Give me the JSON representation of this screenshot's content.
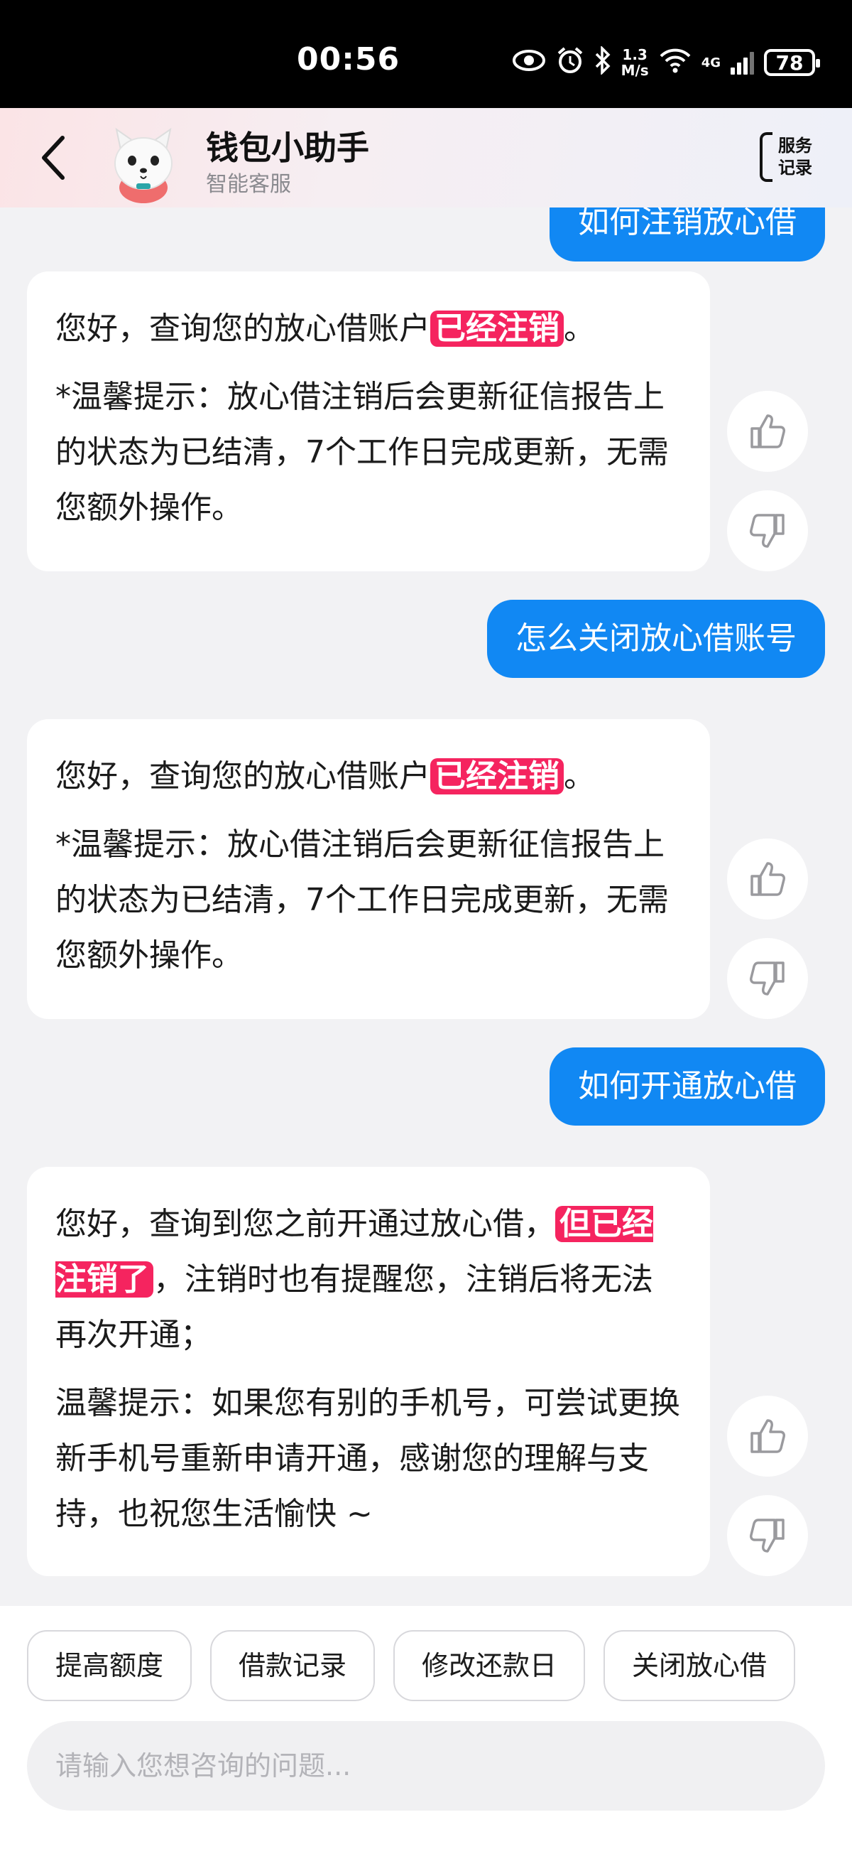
{
  "status_bar": {
    "time": "00:56",
    "speed_value": "1.3",
    "speed_unit": "M/s",
    "network": "4G",
    "battery": "78"
  },
  "header": {
    "title": "钱包小助手",
    "subtitle": "智能客服",
    "service_record_line1": "服务",
    "service_record_line2": "记录"
  },
  "messages": {
    "partial_user": "如何注销放心借",
    "bot1": {
      "p1_pre": "您好，查询您的放心借账户",
      "p1_hl": "已经注销",
      "p1_post": "。",
      "p2": "*温馨提示：放心借注销后会更新征信报告上的状态为已结清，7个工作日完成更新，无需您额外操作。"
    },
    "user2": "怎么关闭放心借账号",
    "bot2": {
      "p1_pre": "您好，查询您的放心借账户",
      "p1_hl": "已经注销",
      "p1_post": "。",
      "p2": "*温馨提示：放心借注销后会更新征信报告上的状态为已结清，7个工作日完成更新，无需您额外操作。"
    },
    "user3": "如何开通放心借",
    "bot3": {
      "p1_pre": "您好，查询到您之前开通过放心借，",
      "p1_hl": "但已经注销了",
      "p1_post": "，注销时也有提醒您，注销后将无法再次开通；",
      "p2": "温馨提示：如果您有别的手机号，可尝试更换新手机号重新申请开通，感谢您的理解与支持，也祝您生活愉快 ~"
    }
  },
  "quick_replies": [
    "提高额度",
    "借款记录",
    "修改还款日",
    "关闭放心借"
  ],
  "input": {
    "placeholder": "请输入您想咨询的问题..."
  },
  "colors": {
    "user_bubble": "#1188f3",
    "highlight": "#f5245f"
  }
}
